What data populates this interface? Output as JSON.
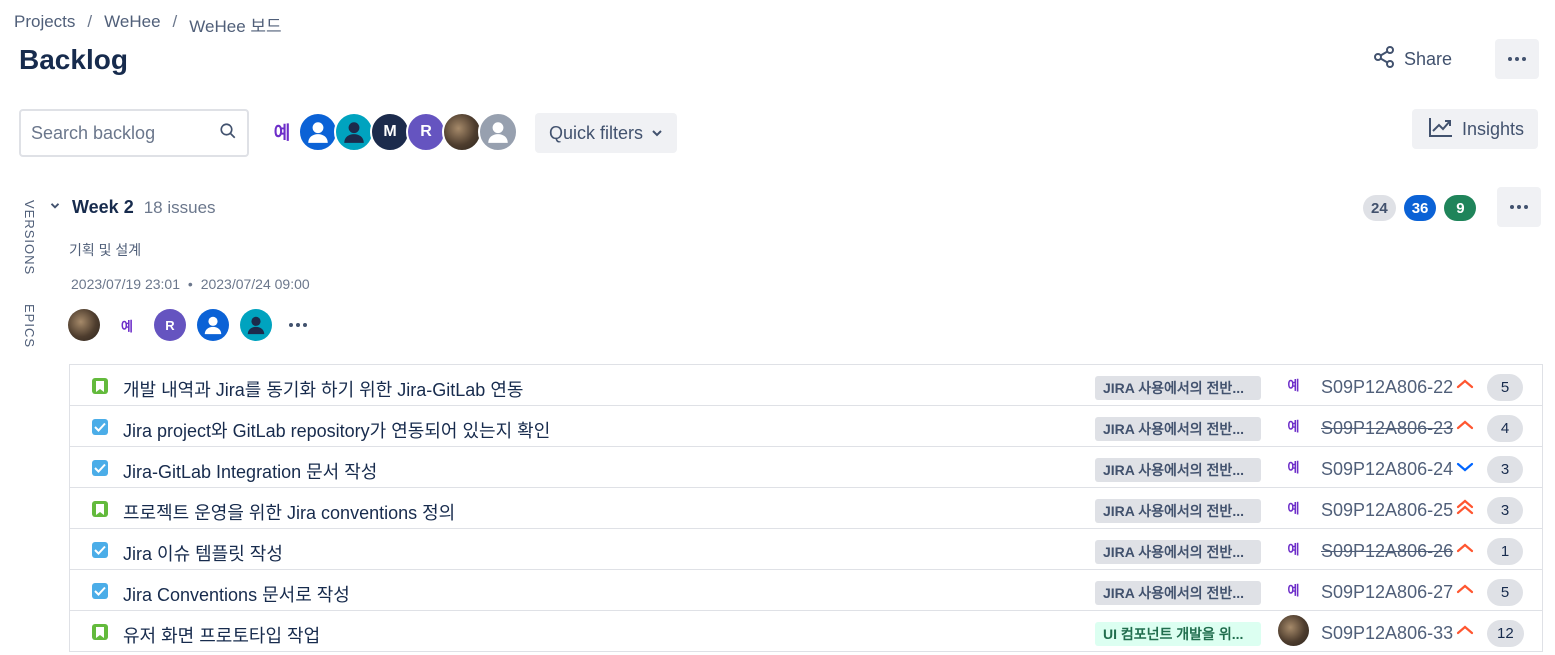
{
  "breadcrumb": [
    "Projects",
    "WeHee",
    "WeHee 보드"
  ],
  "page_title": "Backlog",
  "header": {
    "share_label": "Share"
  },
  "search": {
    "placeholder": "Search backlog"
  },
  "filter_avatars": [
    {
      "text": "예",
      "style": "text"
    },
    {
      "text": "",
      "style": "blue"
    },
    {
      "text": "",
      "style": "teal"
    },
    {
      "text": "M",
      "style": "navy"
    },
    {
      "text": "R",
      "style": "purple"
    },
    {
      "text": "",
      "style": "photo"
    },
    {
      "text": "",
      "style": "gray"
    }
  ],
  "quick_filters_label": "Quick filters",
  "insights_label": "Insights",
  "side_tabs": {
    "versions": "VERSIONS",
    "epics": "EPICS"
  },
  "sprint": {
    "name": "Week 2",
    "issue_count": "18 issues",
    "goal": "기획 및 설계",
    "start": "2023/07/19 23:01",
    "end": "2023/07/24 09:00",
    "counts": {
      "todo": "24",
      "in_progress": "36",
      "done": "9"
    },
    "assignees": [
      {
        "text": "",
        "style": "photo"
      },
      {
        "text": "예",
        "style": "text"
      },
      {
        "text": "R",
        "style": "purple"
      },
      {
        "text": "",
        "style": "blue"
      },
      {
        "text": "",
        "style": "teal"
      }
    ]
  },
  "issues": [
    {
      "type": "story",
      "summary": "개발 내역과 Jira를 동기화 하기 위한 Jira-GitLab 연동",
      "epic": "JIRA 사용에서의 전반...",
      "epic_color": "gray",
      "assignee": "예",
      "assignee_style": "text",
      "key": "S09P12A806-22",
      "done": false,
      "priority": "high",
      "estimate": "5"
    },
    {
      "type": "task",
      "summary": "Jira project와 GitLab repository가 연동되어 있는지 확인",
      "epic": "JIRA 사용에서의 전반...",
      "epic_color": "gray",
      "assignee": "예",
      "assignee_style": "text",
      "key": "S09P12A806-23",
      "done": true,
      "priority": "high",
      "estimate": "4"
    },
    {
      "type": "task",
      "summary": "Jira-GitLab Integration 문서 작성",
      "epic": "JIRA 사용에서의 전반...",
      "epic_color": "gray",
      "assignee": "예",
      "assignee_style": "text",
      "key": "S09P12A806-24",
      "done": false,
      "priority": "low",
      "estimate": "3"
    },
    {
      "type": "story",
      "summary": "프로젝트 운영을 위한 Jira conventions 정의",
      "epic": "JIRA 사용에서의 전반...",
      "epic_color": "gray",
      "assignee": "예",
      "assignee_style": "text",
      "key": "S09P12A806-25",
      "done": false,
      "priority": "highest",
      "estimate": "3"
    },
    {
      "type": "task",
      "summary": "Jira 이슈 템플릿 작성",
      "epic": "JIRA 사용에서의 전반...",
      "epic_color": "gray",
      "assignee": "예",
      "assignee_style": "text",
      "key": "S09P12A806-26",
      "done": true,
      "priority": "high",
      "estimate": "1"
    },
    {
      "type": "task",
      "summary": "Jira Conventions 문서로 작성",
      "epic": "JIRA 사용에서의 전반...",
      "epic_color": "gray",
      "assignee": "예",
      "assignee_style": "text",
      "key": "S09P12A806-27",
      "done": false,
      "priority": "high",
      "estimate": "5"
    },
    {
      "type": "story",
      "summary": "유저 화면 프로토타입 작업",
      "epic": "UI 컴포넌트 개발을 위...",
      "epic_color": "green",
      "assignee": "",
      "assignee_style": "photo",
      "key": "S09P12A806-33",
      "done": false,
      "priority": "high",
      "estimate": "12"
    }
  ],
  "colors": {
    "text": "#172b4d",
    "accent": "#0b62d6",
    "priority_high": "#ff5630",
    "priority_low": "#0065ff",
    "story": "#63ba3c",
    "task": "#4bade8"
  }
}
